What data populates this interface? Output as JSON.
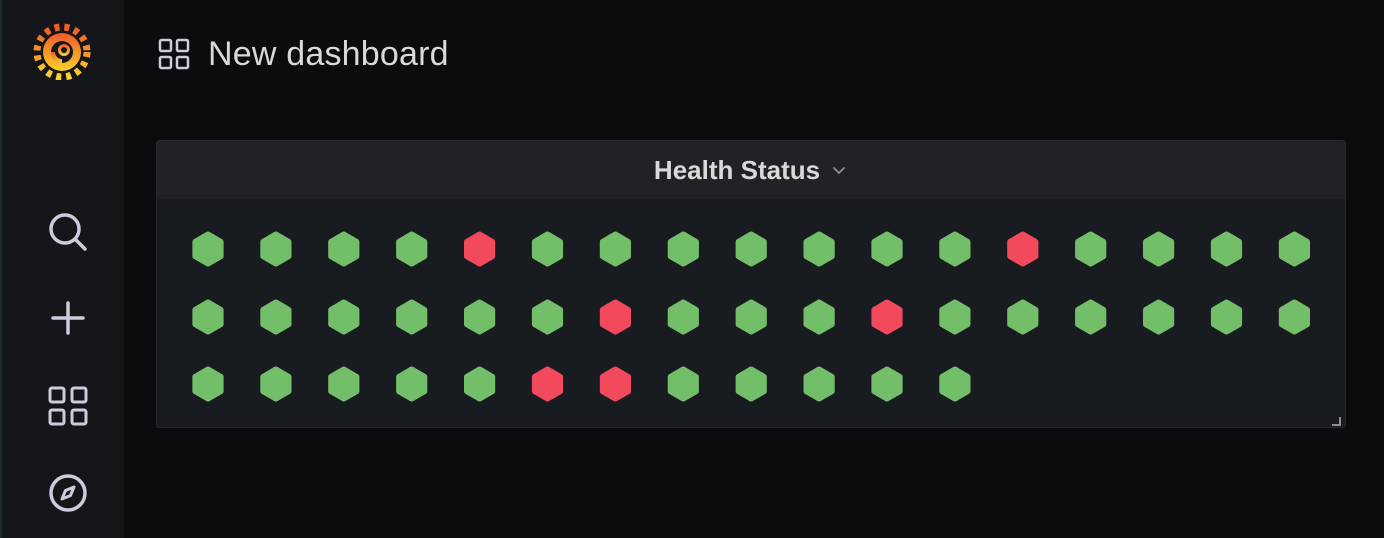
{
  "dashboard": {
    "title": "New dashboard"
  },
  "panel": {
    "title": "Health Status"
  },
  "sidebar": {
    "items": [
      {
        "name": "search-icon"
      },
      {
        "name": "plus-icon"
      },
      {
        "name": "dashboards-icon"
      },
      {
        "name": "explore-icon"
      }
    ]
  },
  "colors": {
    "ok": "#73bf69",
    "fail": "#f2495c",
    "background": "#0b0c0e",
    "panel": "#181b1f",
    "panel_header": "#202226",
    "icon": "#ccccdc"
  },
  "health_grid": {
    "rows": [
      [
        "ok",
        "ok",
        "ok",
        "ok",
        "fail",
        "ok",
        "ok",
        "ok",
        "ok",
        "ok",
        "ok",
        "ok",
        "fail",
        "ok",
        "ok",
        "ok",
        "ok"
      ],
      [
        "ok",
        "ok",
        "ok",
        "ok",
        "ok",
        "ok",
        "fail",
        "ok",
        "ok",
        "ok",
        "fail",
        "ok",
        "ok",
        "ok",
        "ok",
        "ok",
        "ok"
      ],
      [
        "ok",
        "ok",
        "ok",
        "ok",
        "ok",
        "fail",
        "fail",
        "ok",
        "ok",
        "ok",
        "ok",
        "ok"
      ]
    ]
  }
}
